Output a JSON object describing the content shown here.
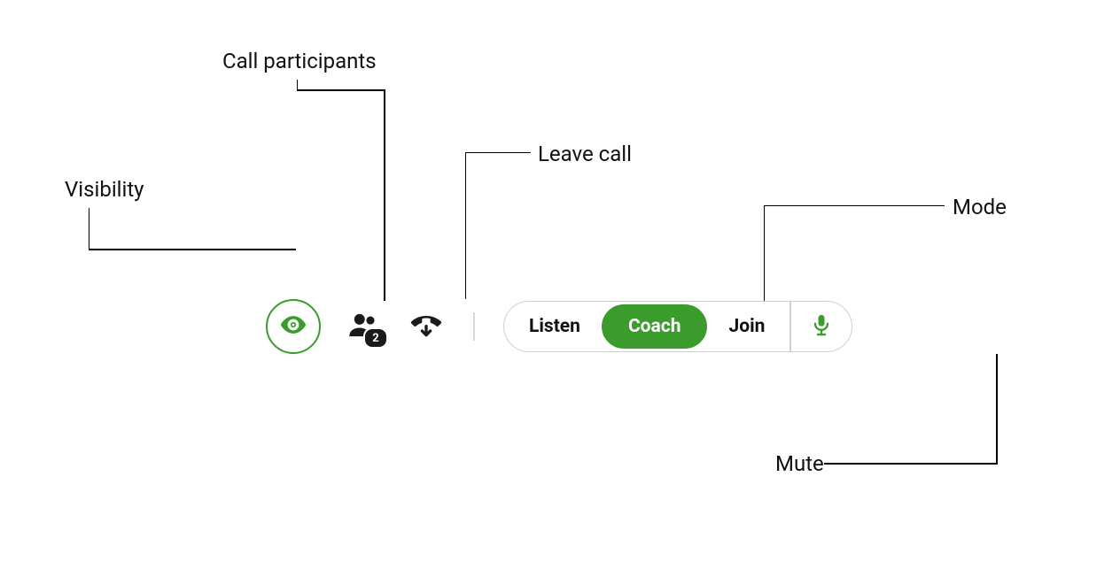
{
  "labels": {
    "visibility": "Visibility",
    "participants": "Call participants",
    "leave": "Leave call",
    "mode": "Mode",
    "mute": "Mute"
  },
  "toolbar": {
    "visibility_icon": "eye-icon",
    "participants_count": "2",
    "leave_icon": "hangup-icon",
    "mute_icon": "mic-icon"
  },
  "modes": {
    "options": [
      {
        "label": "Listen",
        "active": false
      },
      {
        "label": "Coach",
        "active": true
      },
      {
        "label": "Join",
        "active": false
      }
    ]
  },
  "colors": {
    "accent": "#3a9d2b",
    "ink": "#1a1a1a",
    "border": "#d0d0d0"
  }
}
